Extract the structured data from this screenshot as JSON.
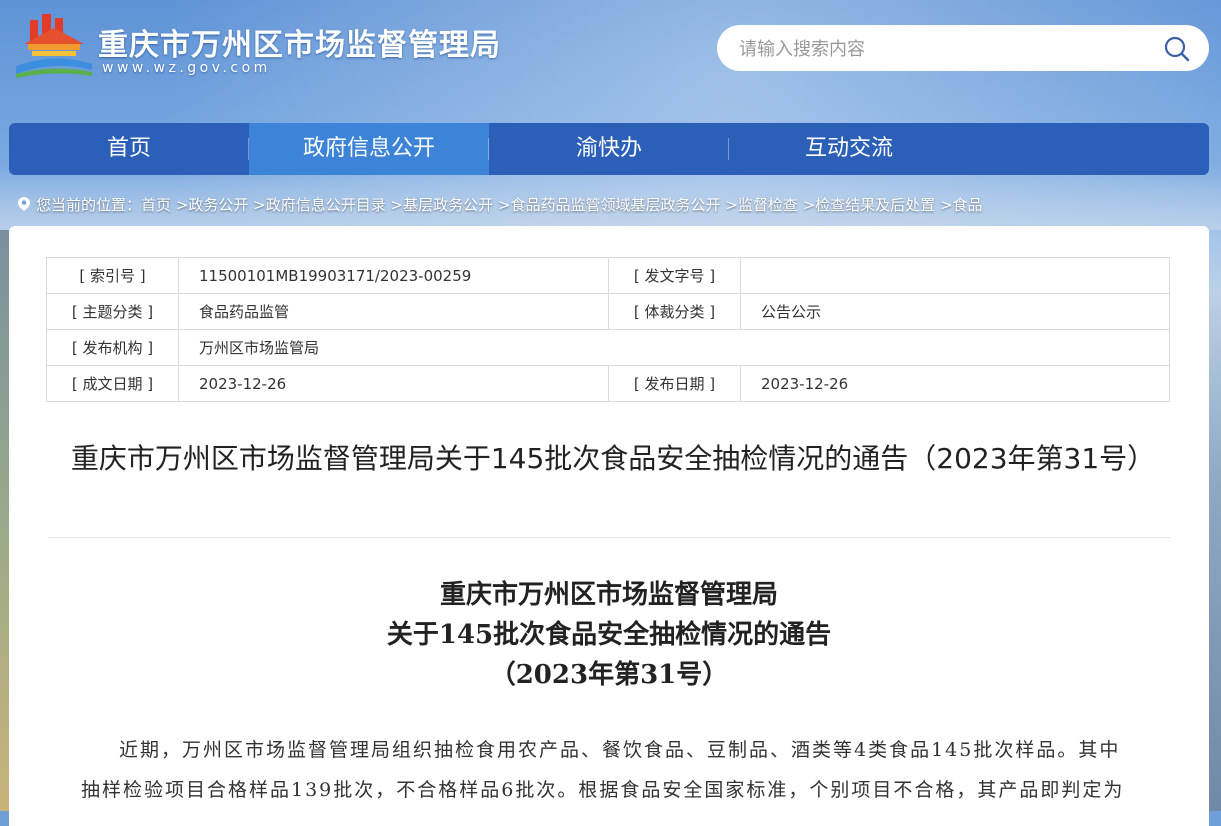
{
  "header": {
    "site_title": "重庆市万州区市场监督管理局",
    "site_url": "www.wz.gov.com",
    "search_placeholder": "请输入搜索内容"
  },
  "nav": {
    "items": [
      {
        "label": "首页"
      },
      {
        "label": "政府信息公开",
        "active": true
      },
      {
        "label": "渝快办"
      },
      {
        "label": "互动交流"
      }
    ]
  },
  "breadcrumb": {
    "prefix": "您当前的位置：",
    "items": [
      "首页",
      ">政务公开",
      ">政府信息公开目录",
      ">基层政务公开",
      ">食品药品监管领域基层政务公开",
      ">监督检查",
      ">检查结果及后处置",
      ">食品"
    ]
  },
  "meta": {
    "index_label": "[ 索引号 ]",
    "index_value": "11500101MB19903171/2023-00259",
    "doc_no_label": "[ 发文字号 ]",
    "doc_no_value": "",
    "topic_label": "[ 主题分类 ]",
    "topic_value": "食品药品监管",
    "genre_label": "[ 体裁分类 ]",
    "genre_value": "公告公示",
    "org_label": "[ 发布机构 ]",
    "org_value": "万州区市场监管局",
    "created_label": "[ 成文日期 ]",
    "created_value": "2023-12-26",
    "published_label": "[ 发布日期 ]",
    "published_value": "2023-12-26"
  },
  "article": {
    "title": "重庆市万州区市场监督管理局关于145批次食品安全抽检情况的通告（2023年第31号）",
    "sub1": "重庆市万州区市场监督管理局",
    "sub2": "关于145批次食品安全抽检情况的通告",
    "sub3": "（2023年第31号）",
    "body": "近期，万州区市场监督管理局组织抽检食用农产品、餐饮食品、豆制品、酒类等4类食品145批次样品。其中抽样检验项目合格样品139批次，不合格样品6批次。根据食品安全国家标准，个别项目不合格，其产品即判定为"
  },
  "colors": {
    "nav_bg": "#2c5fb8",
    "nav_active": "#3d84d8"
  }
}
